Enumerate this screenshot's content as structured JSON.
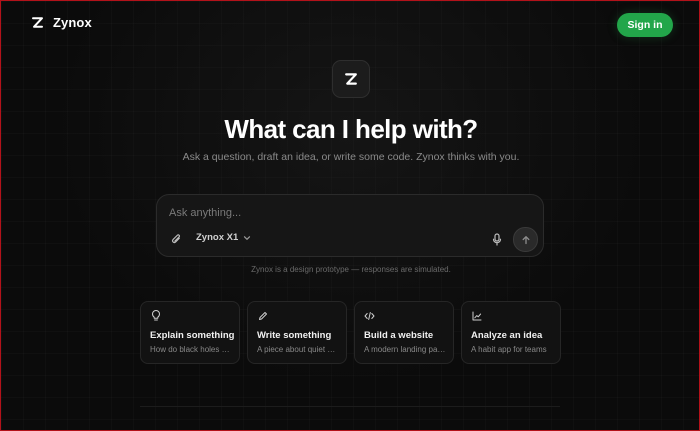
{
  "header": {
    "brand_name": "Zynox",
    "signin_label": "Sign in",
    "accent_color": "#22a64a"
  },
  "hero": {
    "logo_icon": "z-logo-icon",
    "headline": "What can I help with?",
    "subline": "Ask a question, draft an idea, or write some code. Zynox thinks with you."
  },
  "composer": {
    "placeholder": "Ask anything...",
    "value": "",
    "model_label": "Zynox X1",
    "icons": [
      "paperclip-icon",
      "chevron-down-icon",
      "microphone-icon",
      "arrow-up-icon"
    ]
  },
  "disclaimer": "Zynox is a design prototype — responses are simulated.",
  "suggestions": [
    {
      "icon": "lightbulb-icon",
      "title": "Explain something",
      "subtitle": "How do black holes work?"
    },
    {
      "icon": "pencil-icon",
      "title": "Write something",
      "subtitle": "A piece about quiet mornings"
    },
    {
      "icon": "code-icon",
      "title": "Build a website",
      "subtitle": "A modern landing page"
    },
    {
      "icon": "chart-icon",
      "title": "Analyze an idea",
      "subtitle": "A habit app for teams"
    }
  ]
}
